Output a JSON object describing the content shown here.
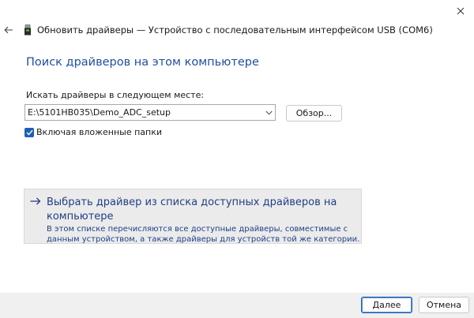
{
  "window": {
    "title": "Обновить драйверы — Устройство с последовательным интерфейсом USB (COM6)",
    "close_icon": "close-icon",
    "back_icon": "back-arrow-icon",
    "device_icon": "usb-device-icon"
  },
  "main": {
    "heading": "Поиск драйверов на этом компьютере",
    "path_label": "Искать драйверы в следующем месте:",
    "path_value": "E:\\5101HB035\\Demo_ADC_setup",
    "browse_label": "Обзор...",
    "include_subfolders_label": "Включая вложенные папки",
    "include_subfolders_checked": true
  },
  "pick_option": {
    "title": "Выбрать драйвер из списка доступных драйверов на компьютере",
    "description": "В этом списке перечисляются все доступные драйверы, совместимые с данным устройством, а также драйверы для устройств той же категории."
  },
  "footer": {
    "next_label": "Далее",
    "cancel_label": "Отмена"
  },
  "colors": {
    "accent": "#1f5fb8",
    "heading": "#1f4fa0",
    "link_text": "#1f3f86",
    "footer_bg": "#f0f0f0"
  }
}
